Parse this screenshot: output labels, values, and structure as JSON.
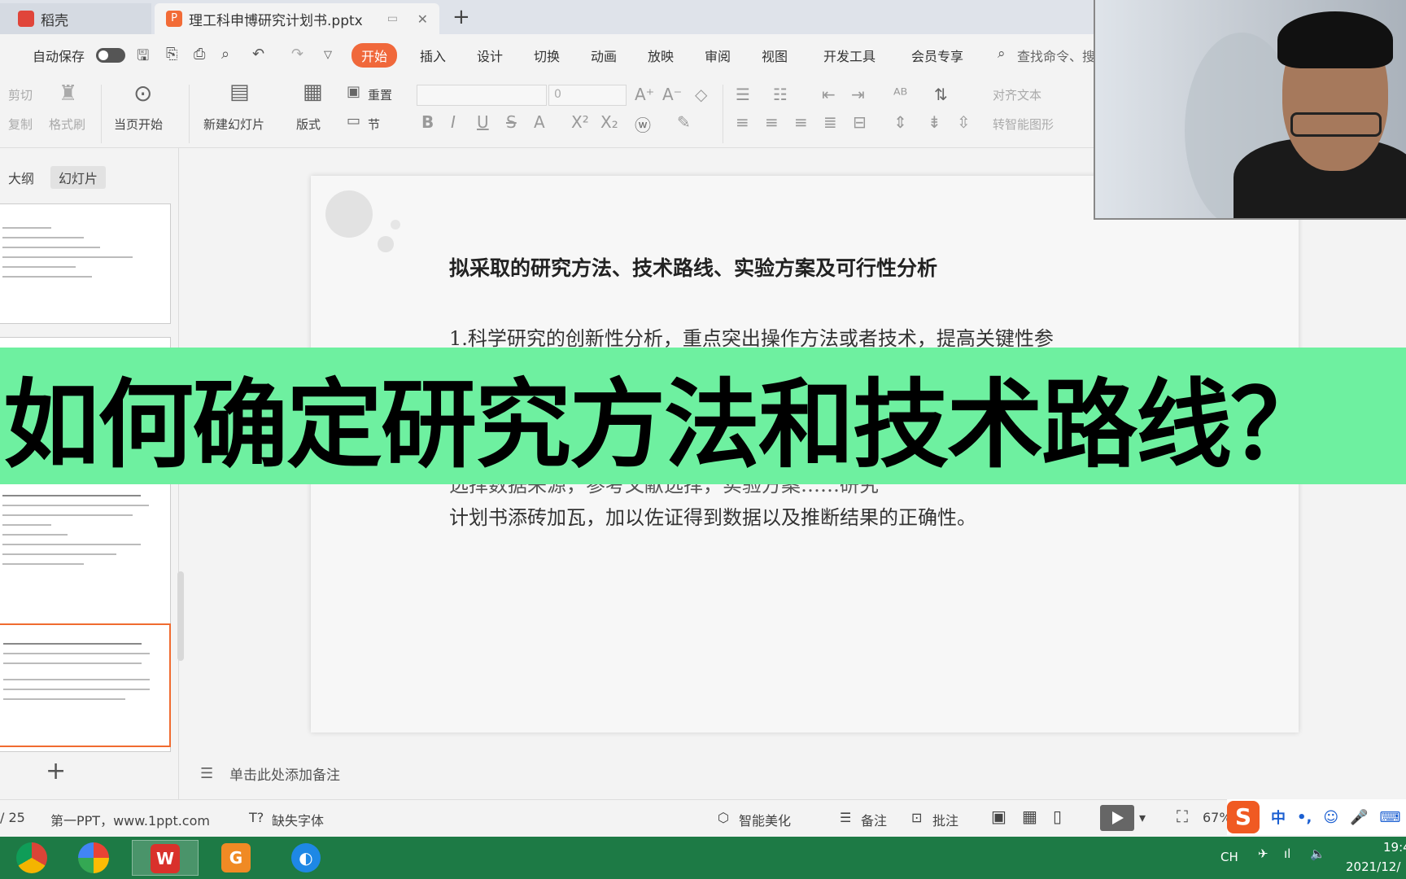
{
  "tabs": [
    {
      "label": "稻壳"
    },
    {
      "label": "理工科申博研究计划书.pptx"
    }
  ],
  "quickbar": {
    "autosave_label": "自动保存"
  },
  "menu": [
    {
      "label": "开始",
      "active": true
    },
    {
      "label": "插入"
    },
    {
      "label": "设计"
    },
    {
      "label": "切换"
    },
    {
      "label": "动画"
    },
    {
      "label": "放映"
    },
    {
      "label": "审阅"
    },
    {
      "label": "视图"
    },
    {
      "label": "开发工具"
    },
    {
      "label": "会员专享"
    }
  ],
  "search": {
    "placeholder": "查找命令、搜"
  },
  "ribbon": {
    "cut": "剪切",
    "copy": "复制",
    "format_painter": "格式刷",
    "play_from_current": "当页开始",
    "new_slide": "新建幻灯片",
    "layout": "版式",
    "section": "节",
    "reset": "重置",
    "font_size": "0",
    "align_text": "对齐文本",
    "smart_art": "转智能图形"
  },
  "left_panel": {
    "tabs": [
      "大纲",
      "幻灯片"
    ],
    "selected_tab": "幻灯片"
  },
  "slide": {
    "title": "拟采取的研究方法、技术路线、实验方案及可行性分析",
    "para1": "1.科学研究的创新性分析，重点突出操作方法或者技术，提高关键性参",
    "para2_fragment": "选择数据来源，参考文献选择，实验方案……研究",
    "para3": "计划书添砖加瓦，加以佐证得到数据以及推断结果的正确性。"
  },
  "notes": {
    "placeholder": "单击此处添加备注"
  },
  "statusbar": {
    "page": "/ 25",
    "theme": "第一PPT，www.1ppt.com",
    "missing_font": "缺失字体",
    "beautify": "智能美化",
    "notes_btn": "备注",
    "comment_btn": "批注",
    "zoom": "67%"
  },
  "banner": {
    "text": "如何确定研究方法和技术路线？"
  },
  "ime": {
    "mode": "中"
  },
  "taskbar": {
    "lang": "CH",
    "time": "19:4",
    "date": "2021/12/"
  },
  "colors": {
    "accent": "#f0683b",
    "banner": "#6ef0a0",
    "taskbar": "#1d7a45"
  },
  "icons": [
    "daoke-icon",
    "pptx-file-icon",
    "close-icon",
    "add-tab-icon",
    "save-icon",
    "print-icon",
    "undo-icon",
    "redo-icon",
    "search-icon",
    "play-icon",
    "chrome-icon",
    "wps-icon",
    "pdf-icon"
  ]
}
